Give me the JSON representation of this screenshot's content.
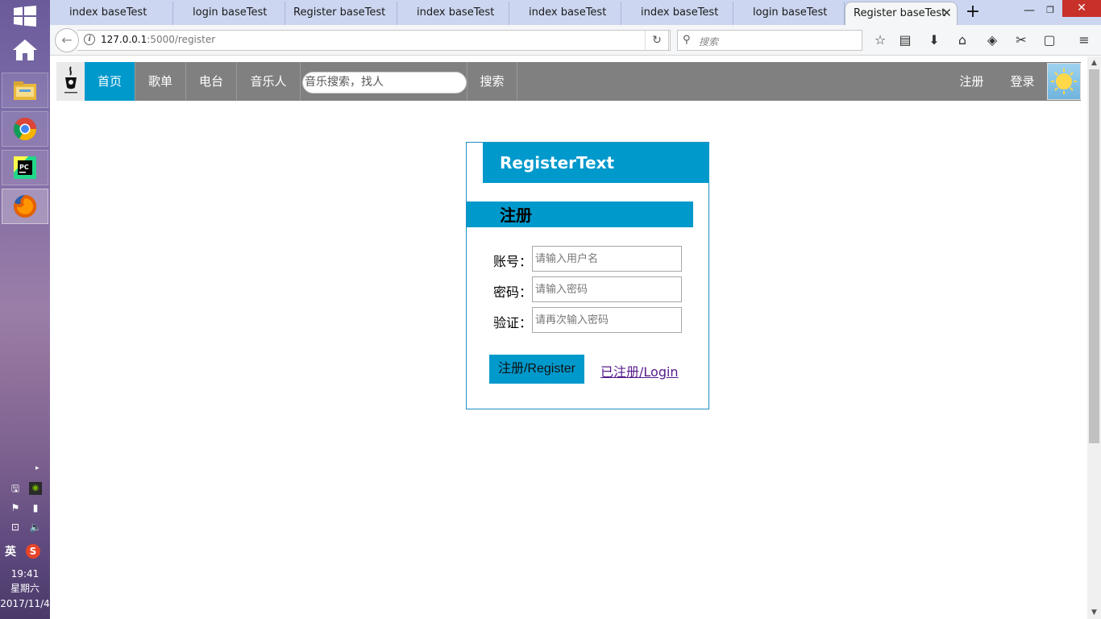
{
  "taskbar": {
    "pinned": [
      "home",
      "file-explorer",
      "chrome",
      "pycharm",
      "firefox"
    ],
    "clock": {
      "time": "19:41",
      "weekday": "星期六",
      "date": "2017/11/4"
    },
    "ime": "英",
    "sogou": "S"
  },
  "browser": {
    "tabs": [
      {
        "label": "index baseTest"
      },
      {
        "label": "login baseTest"
      },
      {
        "label": "Register baseTest"
      },
      {
        "label": "index baseTest"
      },
      {
        "label": "index baseTest"
      },
      {
        "label": "index baseTest"
      },
      {
        "label": "login baseTest"
      },
      {
        "label": "Register baseTest",
        "selected": true
      }
    ],
    "url_host": "127.0.0.1",
    "url_path": ":5000/register",
    "search_placeholder": "搜索"
  },
  "site": {
    "nav": [
      {
        "label": "首页",
        "active": true
      },
      {
        "label": "歌单"
      },
      {
        "label": "电台"
      },
      {
        "label": "音乐人"
      }
    ],
    "search_placeholder": "音乐搜索，找人",
    "search_button": "搜索",
    "register_link": "注册",
    "login_link": "登录"
  },
  "register": {
    "title": "RegisterText",
    "section": "注册",
    "fields": [
      {
        "label": "账号：",
        "placeholder": "请输入用户名"
      },
      {
        "label": "密码：",
        "placeholder": "请输入密码"
      },
      {
        "label": "验证：",
        "placeholder": "请再次输入密码"
      }
    ],
    "submit_label": "注册/Register",
    "login_link": "已注册/Login"
  },
  "colors": {
    "accent": "#0099cc",
    "header_bg": "#808080",
    "link_visited": "#551a8b"
  }
}
